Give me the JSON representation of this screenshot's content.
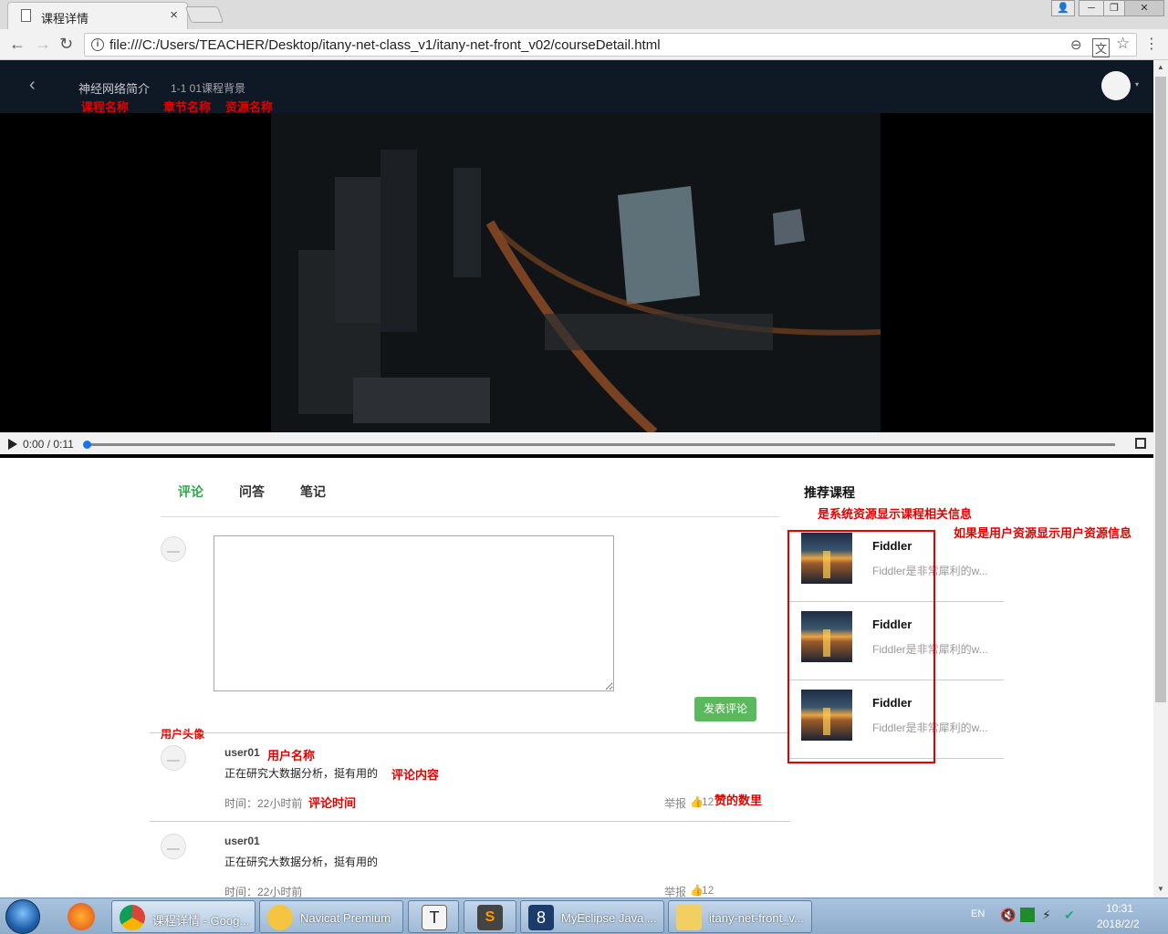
{
  "browser": {
    "tab_title": "课程详情",
    "tab_close": "×",
    "url": "file:///C:/Users/TEACHER/Desktop/itany-net-class_v1/itany-net-front_v02/courseDetail.html",
    "back_icon": "←",
    "forward_icon": "→",
    "reload_icon": "↻",
    "star_icon": "☆",
    "zoom_icon": "⊖",
    "window_min": "─",
    "window_max": "❐",
    "window_close": "✕",
    "window_user": "👤"
  },
  "header": {
    "back": "‹",
    "course_name": "神经网络简介",
    "chapter_resource": "1-1 01课程背景",
    "caret": "▾"
  },
  "annotations": {
    "course_name": "课程名称",
    "chapter_name": "章节名称",
    "resource_name": "资源名称",
    "user_avatar": "用户头像",
    "user_name": "用户名称",
    "comment_content": "评论内容",
    "comment_time": "评论时间",
    "like_count": "赞的数里",
    "system_resource": "是系统资源显示课程相关信息",
    "user_resource": "如果是用户资源显示用户资源信息"
  },
  "player": {
    "time": "0:00 / 0:11",
    "progress": 0
  },
  "tabs": [
    "评论",
    "问答",
    "笔记"
  ],
  "comment_form": {
    "value": "",
    "submit": "发表评论"
  },
  "comments": [
    {
      "user": "user01",
      "text": "正在研究大数据分析，挺有用的",
      "time": "时间：22小时前",
      "report": "举报",
      "likes": "12"
    },
    {
      "user": "user01",
      "text": "正在研究大数据分析，挺有用的",
      "time": "时间：22小时前",
      "report": "举报",
      "likes": "12"
    }
  ],
  "recommend": {
    "title": "推荐课程",
    "items": [
      {
        "name": "Fiddler",
        "desc": "Fiddler是非常犀利的w..."
      },
      {
        "name": "Fiddler",
        "desc": "Fiddler是非常犀利的w..."
      },
      {
        "name": "Fiddler",
        "desc": "Fiddler是非常犀利的w..."
      }
    ]
  },
  "taskbar": {
    "items": [
      {
        "label": "课程详情 - Goog..."
      },
      {
        "label": "Navicat Premium"
      },
      {
        "label": ""
      },
      {
        "label": ""
      },
      {
        "label": "MyEclipse Java ..."
      },
      {
        "label": "itany-net-front_v..."
      }
    ],
    "lang": "EN",
    "time": "10:31",
    "date": "2018/2/2"
  },
  "colors": {
    "accent_green": "#2aa948",
    "annotation_red": "#e30000",
    "header_bg": "#0f1925"
  }
}
